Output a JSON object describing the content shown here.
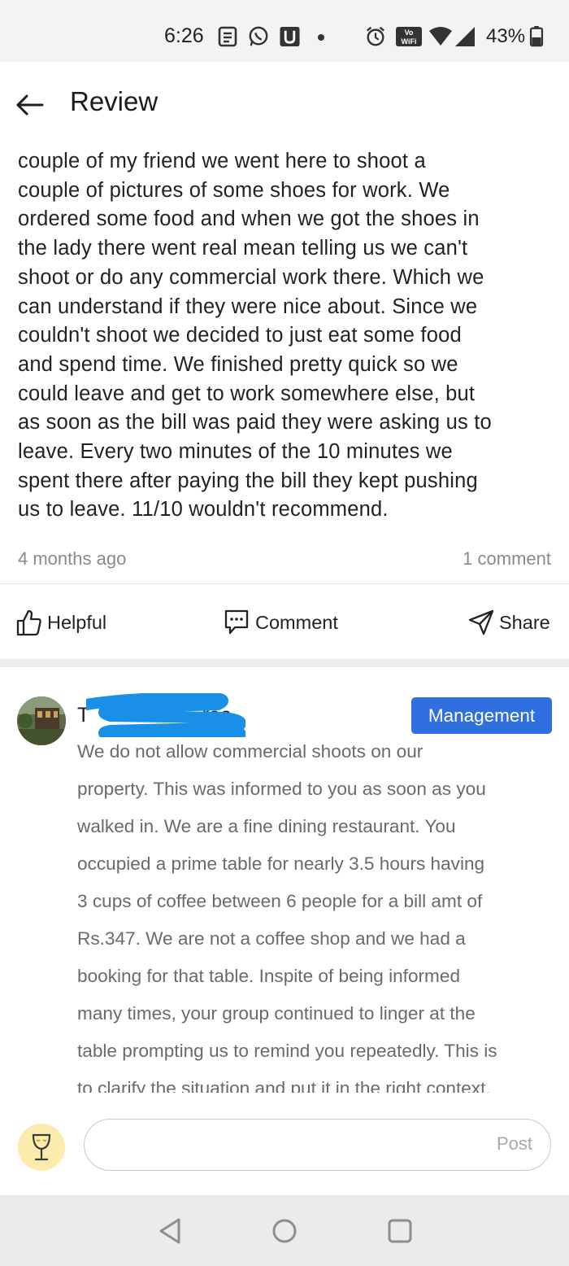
{
  "status_bar": {
    "time": "6:26",
    "battery": "43%",
    "icons": [
      "news-icon",
      "whatsapp-icon",
      "u-app-icon",
      "dot-icon",
      "alarm-icon",
      "vowifi-icon",
      "wifi-icon",
      "signal-icon",
      "battery-icon"
    ],
    "vowifi_label": "Vo WiFi"
  },
  "app_bar": {
    "title": "Review"
  },
  "review": {
    "lines": [
      "couple of my friend we went here to shoot a",
      "couple of pictures of some shoes for work. We",
      "ordered some food and when we got the shoes in",
      "the lady there went real mean telling us we can't",
      "shoot or do any commercial work there. Which we",
      "can understand if they were nice about. Since we",
      "couldn't shoot we decided to just eat some food",
      "and spend time. We finished pretty quick so we",
      "could leave and get to work somewhere else, but",
      "as soon as the bill was paid they were asking us to",
      "leave. Every two minutes of the 10 minutes we",
      "spent there after paying the bill they kept pushing",
      "us to leave. 11/10 wouldn't recommend."
    ],
    "time_ago": "4 months ago",
    "comment_count": "1 comment"
  },
  "actions": {
    "helpful": "Helpful",
    "comment": "Comment",
    "share": "Share"
  },
  "reply": {
    "name_visible": "T                    ree",
    "badge": "Management",
    "lines": [
      "We do not allow commercial shoots on our",
      "property. This was informed to you as soon as you",
      "walked in. We are a fine dining restaurant. You",
      "occupied a prime table for nearly 3.5 hours having",
      "3 cups of coffee between 6 people for a bill amt of",
      "Rs.347. We are not a coffee shop and we had a",
      "booking for that table. Inspite of being informed",
      "many times, your group continued to linger at the",
      "table prompting us to remind you repeatedly. This is",
      "to clarify the situation and put it in the right context."
    ]
  },
  "comment_bar": {
    "input_value": "",
    "post_label": "Post"
  },
  "colors": {
    "management_badge": "#2f6fe0",
    "user_badge_bg": "#fbecae",
    "redaction": "#1a8fe8"
  }
}
